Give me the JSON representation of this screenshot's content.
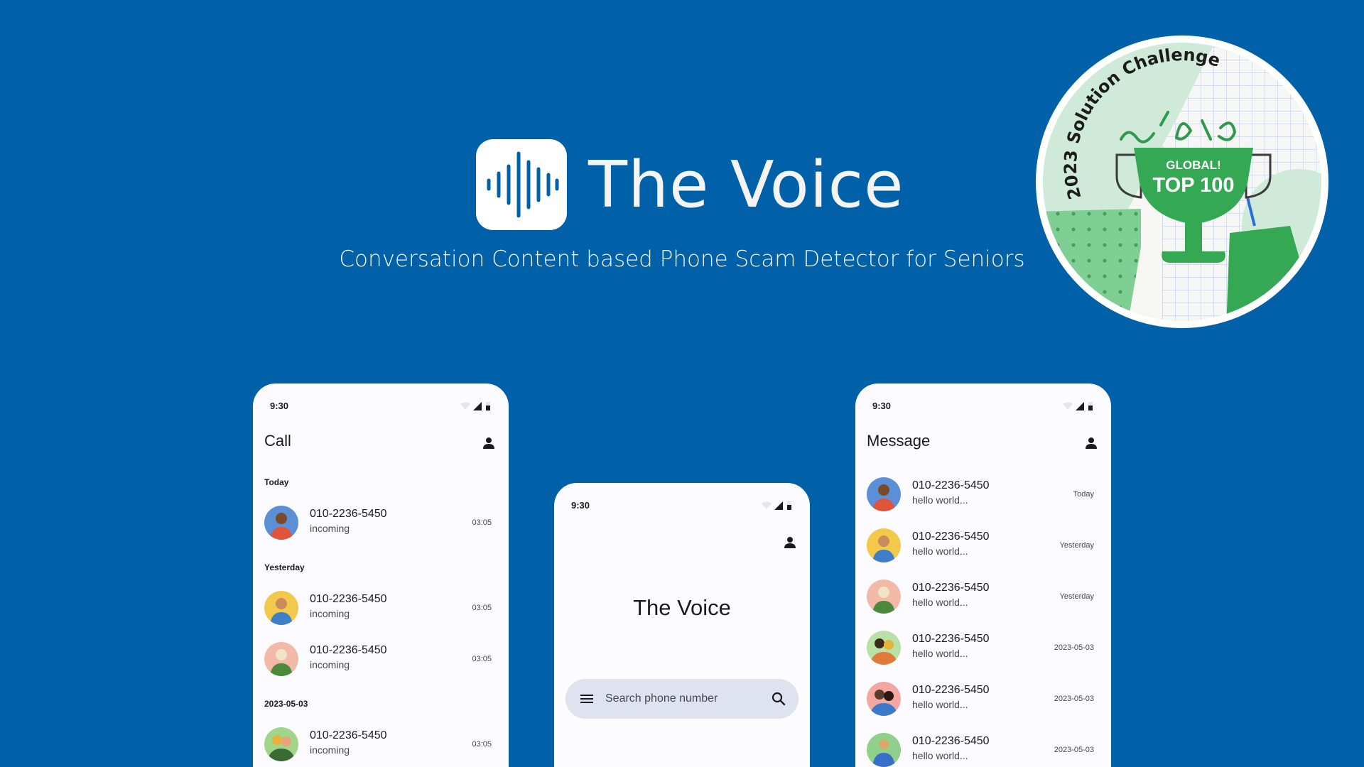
{
  "header": {
    "app_name": "The Voice",
    "tagline": "Conversation Content based Phone Scam Detector for Seniors",
    "logo_icon": "waveform-icon"
  },
  "badge": {
    "arc_text": "2023 Solution Challenge",
    "line1": "GLOBAL!",
    "line2": "TOP 100",
    "colors": {
      "green": "#34a853",
      "light_green": "#cfead8",
      "cream": "#f6f6f4"
    }
  },
  "colors": {
    "background": "#0061a8",
    "phone_surface": "#fcfbff",
    "search_bar": "#dfe3ef",
    "text_primary": "#1b1b1f",
    "text_secondary": "#46464f"
  },
  "call_screen": {
    "status_time": "9:30",
    "title": "Call",
    "sections": [
      {
        "label": "Today",
        "items": [
          {
            "number": "010-2236-5450",
            "type": "incoming",
            "duration": "03:05",
            "avatar_color": "#5b8fd6"
          }
        ]
      },
      {
        "label": "Yesterday",
        "items": [
          {
            "number": "010-2236-5450",
            "type": "incoming",
            "duration": "03:05",
            "avatar_color": "#f3c94c"
          },
          {
            "number": "010-2236-5450",
            "type": "incoming",
            "duration": "03:05",
            "avatar_color": "#f2b8a8"
          }
        ]
      },
      {
        "label": "2023-05-03",
        "items": [
          {
            "number": "010-2236-5450",
            "type": "incoming",
            "duration": "03:05",
            "avatar_color": "#9fd68a"
          }
        ]
      }
    ]
  },
  "home_screen": {
    "status_time": "9:30",
    "title": "The Voice",
    "search_placeholder": "Search phone number"
  },
  "message_screen": {
    "status_time": "9:30",
    "title": "Message",
    "items": [
      {
        "number": "010-2236-5450",
        "preview": "hello world...",
        "date": "Today",
        "avatar_color": "#5b8fd6"
      },
      {
        "number": "010-2236-5450",
        "preview": "hello world...",
        "date": "Yesterday",
        "avatar_color": "#f3c94c"
      },
      {
        "number": "010-2236-5450",
        "preview": "hello world...",
        "date": "Yesterday",
        "avatar_color": "#f2b8a8"
      },
      {
        "number": "010-2236-5450",
        "preview": "hello world...",
        "date": "2023-05-03",
        "avatar_color": "#b9e0a5"
      },
      {
        "number": "010-2236-5450",
        "preview": "hello world...",
        "date": "2023-05-03",
        "avatar_color": "#f4a6a0"
      },
      {
        "number": "010-2236-5450",
        "preview": "hello world...",
        "date": "2023-05-03",
        "avatar_color": "#8fd08a"
      }
    ]
  }
}
